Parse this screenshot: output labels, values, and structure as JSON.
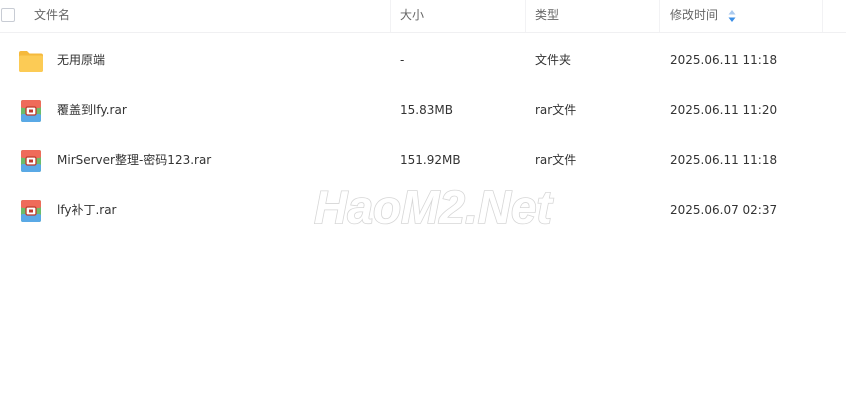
{
  "header": {
    "name": "文件名",
    "size": "大小",
    "type": "类型",
    "modified": "修改时间"
  },
  "files": [
    {
      "name": "无用原端",
      "size": "-",
      "type": "文件夹",
      "modified": "2025.06.11 11:18",
      "icon": "folder-icon"
    },
    {
      "name": "覆盖到lfy.rar",
      "size": "15.83MB",
      "type": "rar文件",
      "modified": "2025.06.11 11:20",
      "icon": "rar-archive-icon"
    },
    {
      "name": "MirServer整理-密码123.rar",
      "size": "151.92MB",
      "type": "rar文件",
      "modified": "2025.06.11 11:18",
      "icon": "rar-archive-icon"
    },
    {
      "name": "lfy补丁.rar",
      "size": "",
      "type": "",
      "modified": "2025.06.07 02:37",
      "icon": "rar-archive-icon"
    }
  ],
  "watermark": "HaoM2.Net",
  "colors": {
    "sort_accent": "#3a8ee6",
    "folder": "#f7c14b",
    "archive_top": "#e9574a",
    "archive_body": "#5fb0e8"
  }
}
